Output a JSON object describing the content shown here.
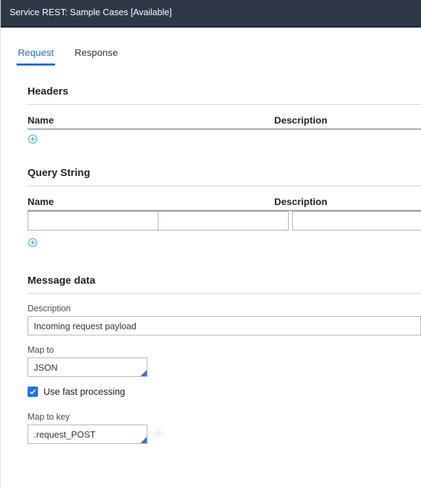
{
  "titlebar": {
    "text": "Service REST: Sample Cases [Available]"
  },
  "tabs": {
    "request": "Request",
    "response": "Response"
  },
  "headers": {
    "title": "Headers",
    "col_name": "Name",
    "col_desc": "Description"
  },
  "query": {
    "title": "Query String",
    "col_name": "Name",
    "col_desc": "Description",
    "row": {
      "name": "",
      "desc": ""
    }
  },
  "message_data": {
    "title": "Message data",
    "description_label": "Description",
    "description_value": "Incoming request payload",
    "map_to_label": "Map to",
    "map_to_value": "JSON",
    "fast_processing_label": "Use fast processing",
    "fast_processing_checked": true,
    "map_to_key_label": "Map to key",
    "map_to_key_value": ".request_POST"
  }
}
